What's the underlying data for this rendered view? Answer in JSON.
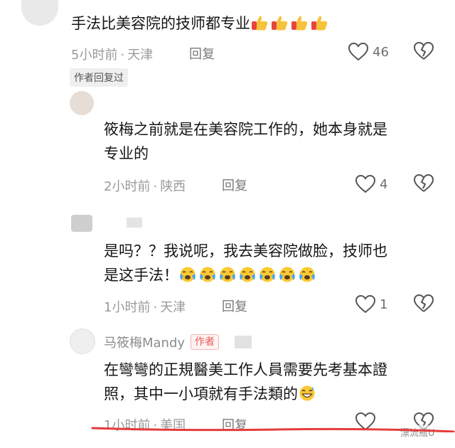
{
  "comments": [
    {
      "text": "手法比美容院的技师都专业",
      "emoji_icons": [
        "thumbs-up-icon",
        "thumbs-up-icon",
        "thumbs-up-icon",
        "thumbs-up-icon"
      ],
      "time": "5小时前",
      "location": "天津",
      "reply_label": "回复",
      "likes": "46",
      "badge": "作者回复过"
    },
    {
      "text_line1": "筱梅之前就是在美容院工作的，她本身就是",
      "text_line2": "专业的",
      "time": "2小时前",
      "location": "陕西",
      "reply_label": "回复",
      "likes": "4"
    },
    {
      "text_line1": "是吗？？我说呢，我去美容院做脸，技师也",
      "text_line2": "是这手法！",
      "emoji_icons": [
        "crying-face-icon",
        "crying-face-icon",
        "crying-face-icon",
        "crying-face-icon",
        "crying-face-icon",
        "crying-face-icon",
        "crying-face-icon"
      ],
      "time": "1小时前",
      "location": "天津",
      "reply_label": "回复",
      "likes": "1"
    },
    {
      "username": "马筱梅Mandy",
      "author_badge": "作者",
      "text_line1": "在彎彎的正規醫美工作人員需要先考基本證",
      "text_line2": "照，其中一小項就有手法類的",
      "emoji_icons": [
        "grinning-sweat-icon"
      ],
      "time": "1小时前",
      "location": "美国",
      "reply_label": "回复"
    }
  ],
  "separator": "·",
  "watermark": "漂流瓶U",
  "colors": {
    "meta_text": "#9a9a9a",
    "author_badge": "#e85a5a",
    "underline": "#e53b3b"
  }
}
